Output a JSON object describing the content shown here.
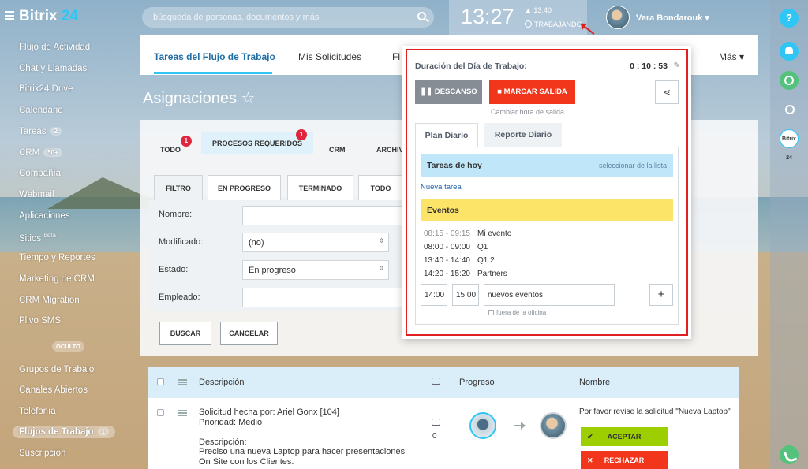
{
  "header": {
    "logo_text": "Bitrix",
    "logo_num": "24",
    "search_placeholder": "búsqueda de personas, documentos y más",
    "time": "13:27",
    "alarm": "13:40",
    "work_status": "TRABAJANDO",
    "user_name": "Vera Bondarouk"
  },
  "sidebar": {
    "items": [
      {
        "label": "Flujo de Actividad"
      },
      {
        "label": "Chat y Llamadas"
      },
      {
        "label": "Bitrix24.Drive"
      },
      {
        "label": "Calendario"
      },
      {
        "label": "Tareas",
        "count": "2"
      },
      {
        "label": "CRM",
        "count": "50+"
      },
      {
        "label": "Compañía"
      },
      {
        "label": "Webmail"
      },
      {
        "label": "Aplicaciones"
      },
      {
        "label": "Sitios",
        "sup": "beta"
      },
      {
        "label": "Tiempo y Reportes"
      },
      {
        "label": "Marketing de CRM"
      },
      {
        "label": "CRM Migration"
      },
      {
        "label": "Plivo SMS"
      }
    ],
    "hidden_label": "OCULTO",
    "items2": [
      {
        "label": "Grupos de Trabajo"
      },
      {
        "label": "Canales Abiertos"
      },
      {
        "label": "Telefonía"
      },
      {
        "label": "Flujos de Trabajo",
        "count": "1"
      },
      {
        "label": "Suscripción"
      }
    ]
  },
  "nav": {
    "tabs": [
      "Tareas del Flujo de Trabajo",
      "Mis Solicitudes",
      "Fl"
    ],
    "more": "Más"
  },
  "page_title": "Asignaciones ☆",
  "filters": {
    "tabs": [
      "TODO",
      "PROCESOS REQUERIDOS",
      "CRM",
      "ARCHIV"
    ],
    "badge_todo": "1",
    "badge_proc": "1",
    "status_tabs": [
      "FILTRO",
      "EN PROGRESO",
      "TERMINADO",
      "TODO"
    ],
    "fields": [
      {
        "label": "Nombre:",
        "value": ""
      },
      {
        "label": "Modificado:",
        "value": "(no)"
      },
      {
        "label": "Estado:",
        "value": "En progreso"
      },
      {
        "label": "Empleado:",
        "value": ""
      }
    ],
    "search_btn": "BUSCAR",
    "cancel_btn": "CANCELAR"
  },
  "table": {
    "col_desc": "Descripción",
    "col_progress": "Progreso",
    "col_name": "Nombre",
    "row": {
      "line1": "Solicitud hecha por: Ariel Gonx [104]",
      "line2": "Prioridad: Medio",
      "line3": "Descripción:",
      "line4": "Preciso una nueva Laptop para hacer presentaciones On Site con los Clientes.",
      "comments": "0",
      "name": "Por favor revise la solicitud \"Nueva Laptop\"",
      "accept": "ACEPTAR",
      "reject": "RECHAZAR"
    }
  },
  "popup": {
    "title": "Duración del Día de Trabajo:",
    "duration": "0 : 10 : 53",
    "pause_btn": "DESCANSO",
    "checkout_btn": "MARCAR SALIDA",
    "change_exit": "Cambiar hora de salida",
    "tab_plan": "Plan Diario",
    "tab_report": "Reporte Diario",
    "tasks_title": "Tareas de hoy",
    "select_link": "seleccionar de la lista",
    "new_task": "Nueva tarea",
    "events_title": "Eventos",
    "events": [
      {
        "time": "08:15 - 09:15",
        "name": "Mi evento"
      },
      {
        "time": "08:00 - 09:00",
        "name": "Q1"
      },
      {
        "time": "13:40 - 14:40",
        "name": "Q1.2"
      },
      {
        "time": "14:20 - 15:20",
        "name": "Partners"
      }
    ],
    "start": "14:00",
    "end": "15:00",
    "new_event": "nuevos eventos",
    "outside": "fuera de la oficina"
  },
  "rightbar": {
    "help": "?",
    "b24": "Bitrix 24"
  }
}
